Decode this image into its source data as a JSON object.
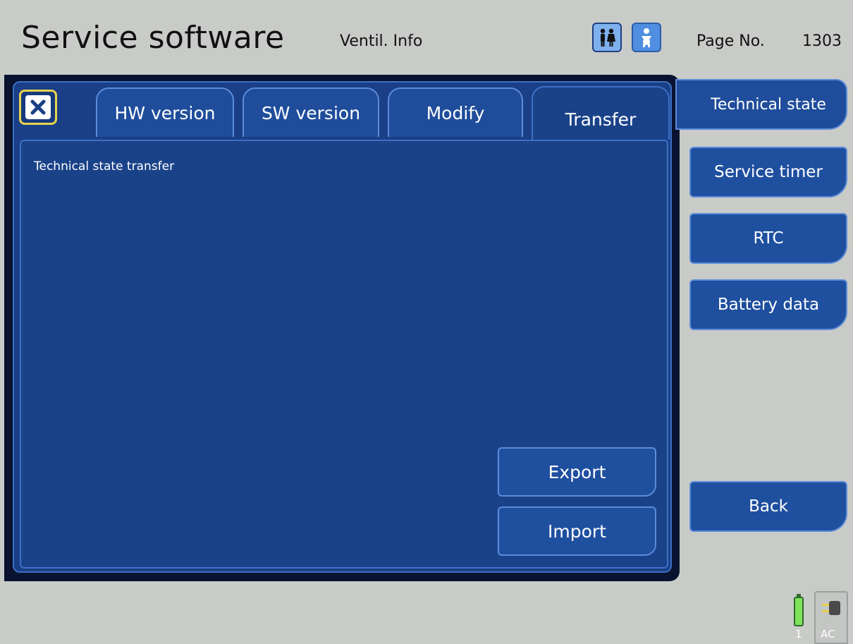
{
  "header": {
    "title": "Service software",
    "subtitle": "Ventil. Info",
    "page_label": "Page No.",
    "page_number": "1303",
    "icons": [
      "adult-patient-icon",
      "infant-patient-icon"
    ]
  },
  "tabs": [
    {
      "label": "HW version",
      "active": false
    },
    {
      "label": "SW version",
      "active": false
    },
    {
      "label": "Modify",
      "active": false
    },
    {
      "label": "Transfer",
      "active": true
    }
  ],
  "content": {
    "title": "Technical state transfer",
    "export_label": "Export",
    "import_label": "Import"
  },
  "sidebar": {
    "active_label": "Technical state",
    "items": [
      {
        "label": "Service timer"
      },
      {
        "label": "RTC"
      },
      {
        "label": "Battery data"
      }
    ],
    "back_label": "Back"
  },
  "status": {
    "battery_number": "1",
    "power_label": "AC",
    "battery_color": "#7ee35c"
  },
  "colors": {
    "panel": "#1a3f86",
    "accent": "#5b8bd9",
    "focus": "#e7d44c",
    "background": "#c9cbc8"
  }
}
